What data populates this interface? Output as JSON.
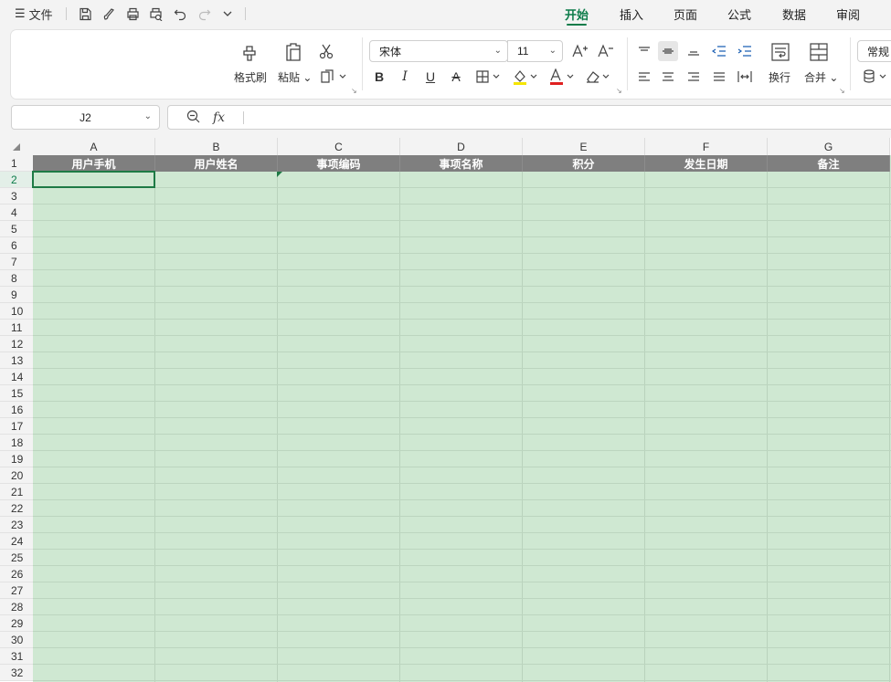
{
  "topbar": {
    "file_menu": "文件",
    "tabs": [
      {
        "label": "开始",
        "active": true
      },
      {
        "label": "插入",
        "active": false
      },
      {
        "label": "页面",
        "active": false
      },
      {
        "label": "公式",
        "active": false
      },
      {
        "label": "数据",
        "active": false
      },
      {
        "label": "审阅",
        "active": false
      }
    ]
  },
  "ribbon": {
    "format_painter": "格式刷",
    "paste": "粘贴",
    "font_name": "宋体",
    "font_size": "11",
    "wrap_text": "换行",
    "merge": "合并",
    "number_format": "常规"
  },
  "formula_bar": {
    "name_box": "J2",
    "formula": ""
  },
  "sheet": {
    "columns": [
      "A",
      "B",
      "C",
      "D",
      "E",
      "F",
      "G"
    ],
    "header_row": [
      "用户手机",
      "用户姓名",
      "事项编码",
      "事项名称",
      "积分",
      "发生日期",
      "备注"
    ],
    "row_numbers": [
      "1",
      "2",
      "3",
      "4",
      "5",
      "6",
      "7",
      "8",
      "9",
      "10",
      "11",
      "12",
      "13",
      "14",
      "15",
      "16",
      "17",
      "18",
      "19",
      "20",
      "21",
      "22",
      "23",
      "24",
      "25",
      "26",
      "27",
      "28",
      "29",
      "30",
      "31",
      "32"
    ],
    "selected_row": "2",
    "colors": {
      "accent": "#0d7c4a",
      "cell_fill": "#cfe8d2",
      "header_fill": "#7f7f7f"
    }
  }
}
